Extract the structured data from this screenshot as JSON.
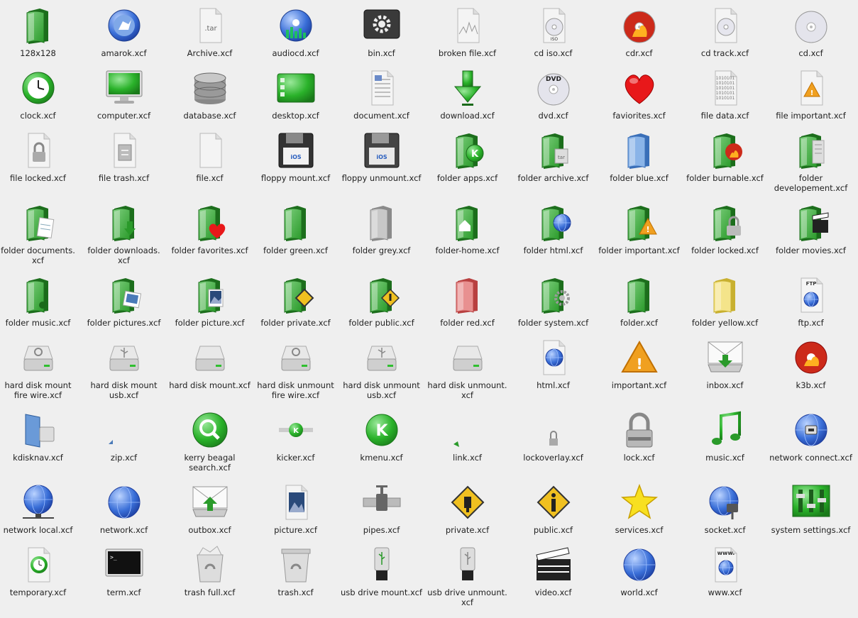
{
  "colors": {
    "background": "#efefef",
    "folder_green": "#3faf3f",
    "folder_green_dark": "#1f7f1f",
    "accent_blue": "#3a6fd8",
    "label_text": "#222222"
  },
  "rows": [
    {
      "items": [
        {
          "name": "folder-icon",
          "label": [
            "128x128"
          ]
        },
        {
          "name": "amarok-icon",
          "label": [
            "amarok.xcf"
          ]
        },
        {
          "name": "tar-archive-icon",
          "label": [
            "Archive.xcf"
          ],
          "text": ".tar"
        },
        {
          "name": "audiocd-icon",
          "label": [
            "audiocd.xcf"
          ]
        },
        {
          "name": "bin-gear-icon",
          "label": [
            "bin.xcf"
          ]
        },
        {
          "name": "broken-file-icon",
          "label": [
            "broken file.xcf"
          ]
        },
        {
          "name": "cd-iso-icon",
          "label": [
            "cd iso.xcf"
          ],
          "text": "ISO"
        },
        {
          "name": "cdr-flame-icon",
          "label": [
            "cdr.xcf"
          ]
        },
        {
          "name": "cd-track-icon",
          "label": [
            "cd track.xcf"
          ]
        },
        {
          "name": "cd-icon",
          "label": [
            "cd.xcf"
          ]
        }
      ]
    },
    {
      "items": [
        {
          "name": "clock-icon",
          "label": [
            "clock.xcf"
          ]
        },
        {
          "name": "computer-monitor-icon",
          "label": [
            "computer.xcf"
          ]
        },
        {
          "name": "database-icon",
          "label": [
            "database.xcf"
          ]
        },
        {
          "name": "desktop-icon",
          "label": [
            "desktop.xcf"
          ]
        },
        {
          "name": "document-icon",
          "label": [
            "document.xcf"
          ]
        },
        {
          "name": "download-arrow-icon",
          "label": [
            "download.xcf"
          ]
        },
        {
          "name": "dvd-icon",
          "label": [
            "dvd.xcf"
          ],
          "text": "DVD"
        },
        {
          "name": "heart-icon",
          "label": [
            "faviorites.xcf"
          ]
        },
        {
          "name": "file-data-icon",
          "label": [
            "file data.xcf"
          ],
          "text": "1010101"
        },
        {
          "name": "file-important-icon",
          "label": [
            "file important.xcf"
          ]
        }
      ]
    },
    {
      "items": [
        {
          "name": "file-locked-icon",
          "label": [
            "file locked.xcf"
          ]
        },
        {
          "name": "file-trash-icon",
          "label": [
            "file trash.xcf"
          ]
        },
        {
          "name": "file-icon",
          "label": [
            "file.xcf"
          ]
        },
        {
          "name": "floppy-mount-icon",
          "label": [
            "floppy mount.xcf"
          ],
          "text": "iOS"
        },
        {
          "name": "floppy-unmount-icon",
          "label": [
            "floppy unmount.xcf"
          ],
          "text": "iOS"
        },
        {
          "name": "folder-apps-icon",
          "label": [
            "folder apps.xcf"
          ],
          "text": "K"
        },
        {
          "name": "folder-archive-icon",
          "label": [
            "folder archive.xcf"
          ],
          "text": "tar"
        },
        {
          "name": "folder-blue-icon",
          "label": [
            "folder blue.xcf"
          ]
        },
        {
          "name": "folder-burnable-icon",
          "label": [
            "folder burnable.xcf"
          ]
        },
        {
          "name": "folder-developement-icon",
          "label": [
            "folder",
            "developement.xcf"
          ]
        }
      ]
    },
    {
      "items": [
        {
          "name": "folder-documents-icon",
          "label": [
            "folder documents.",
            "xcf"
          ]
        },
        {
          "name": "folder-downloads-icon",
          "label": [
            "folder downloads.",
            "xcf"
          ]
        },
        {
          "name": "folder-favorites-icon",
          "label": [
            "folder favorites.xcf"
          ]
        },
        {
          "name": "folder-green-icon",
          "label": [
            "folder green.xcf"
          ]
        },
        {
          "name": "folder-grey-icon",
          "label": [
            "folder grey.xcf"
          ]
        },
        {
          "name": "folder-home-icon",
          "label": [
            "folder-home.xcf"
          ]
        },
        {
          "name": "folder-html-icon",
          "label": [
            "folder html.xcf"
          ]
        },
        {
          "name": "folder-important-icon",
          "label": [
            "folder important.xcf"
          ]
        },
        {
          "name": "folder-locked-icon",
          "label": [
            "folder locked.xcf"
          ]
        },
        {
          "name": "folder-movies-icon",
          "label": [
            "folder movies.xcf"
          ]
        }
      ]
    },
    {
      "items": [
        {
          "name": "folder-music-icon",
          "label": [
            "folder music.xcf"
          ]
        },
        {
          "name": "folder-pictures-icon",
          "label": [
            "folder pictures.xcf"
          ]
        },
        {
          "name": "folder-picture-icon",
          "label": [
            "folder picture.xcf"
          ]
        },
        {
          "name": "folder-private-icon",
          "label": [
            "folder private.xcf"
          ]
        },
        {
          "name": "folder-public-icon",
          "label": [
            "folder public.xcf"
          ]
        },
        {
          "name": "folder-red-icon",
          "label": [
            "folder red.xcf"
          ]
        },
        {
          "name": "folder-system-icon",
          "label": [
            "folder system.xcf"
          ]
        },
        {
          "name": "folder-icon",
          "label": [
            "folder.xcf"
          ]
        },
        {
          "name": "folder-yellow-icon",
          "label": [
            "folder yellow.xcf"
          ]
        },
        {
          "name": "ftp-icon",
          "label": [
            "ftp.xcf"
          ],
          "text": "FTP"
        }
      ]
    },
    {
      "items": [
        {
          "name": "hard-disk-mount-firewire-icon",
          "label": [
            "hard disk mount",
            "fire wire.xcf"
          ]
        },
        {
          "name": "hard-disk-mount-usb-icon",
          "label": [
            "hard disk mount",
            "usb.xcf"
          ]
        },
        {
          "name": "hard-disk-mount-icon",
          "label": [
            "hard disk mount.xcf"
          ]
        },
        {
          "name": "hard-disk-unmount-firewire-icon",
          "label": [
            "hard disk unmount",
            "fire wire.xcf"
          ]
        },
        {
          "name": "hard-disk-unmount-usb-icon",
          "label": [
            "hard disk unmount",
            "usb.xcf"
          ]
        },
        {
          "name": "hard-disk-unmount-icon",
          "label": [
            "hard disk unmount.",
            "xcf"
          ]
        },
        {
          "name": "html-icon",
          "label": [
            "html.xcf"
          ]
        },
        {
          "name": "important-warning-icon",
          "label": [
            "important.xcf"
          ]
        },
        {
          "name": "inbox-icon",
          "label": [
            "inbox.xcf"
          ]
        },
        {
          "name": "k3b-icon",
          "label": [
            "k3b.xcf"
          ]
        }
      ]
    },
    {
      "items": [
        {
          "name": "kdisknav-icon",
          "label": [
            "kdisknav.xcf"
          ]
        },
        {
          "name": "zip-icon",
          "label": [
            "zip.xcf"
          ]
        },
        {
          "name": "kerry-beagal-search-icon",
          "label": [
            "kerry beagal",
            "search.xcf"
          ]
        },
        {
          "name": "kicker-icon",
          "label": [
            "kicker.xcf"
          ],
          "text": "K"
        },
        {
          "name": "kmenu-icon",
          "label": [
            "kmenu.xcf"
          ],
          "text": "K"
        },
        {
          "name": "link-arrow-icon",
          "label": [
            "link.xcf"
          ]
        },
        {
          "name": "lockoverlay-icon",
          "label": [
            "lockoverlay.xcf"
          ]
        },
        {
          "name": "lock-icon",
          "label": [
            "lock.xcf"
          ]
        },
        {
          "name": "music-note-icon",
          "label": [
            "music.xcf"
          ]
        },
        {
          "name": "network-connect-icon",
          "label": [
            "network connect.xcf"
          ]
        }
      ]
    },
    {
      "items": [
        {
          "name": "network-local-icon",
          "label": [
            "network local.xcf"
          ]
        },
        {
          "name": "network-globe-icon",
          "label": [
            "network.xcf"
          ]
        },
        {
          "name": "outbox-icon",
          "label": [
            "outbox.xcf"
          ]
        },
        {
          "name": "picture-icon",
          "label": [
            "picture.xcf"
          ]
        },
        {
          "name": "pipes-icon",
          "label": [
            "pipes.xcf"
          ]
        },
        {
          "name": "private-sign-icon",
          "label": [
            "private.xcf"
          ]
        },
        {
          "name": "public-sign-icon",
          "label": [
            "public.xcf"
          ]
        },
        {
          "name": "star-icon",
          "label": [
            "services.xcf"
          ]
        },
        {
          "name": "socket-icon",
          "label": [
            "socket.xcf"
          ]
        },
        {
          "name": "system-settings-icon",
          "label": [
            "system settings.xcf"
          ]
        }
      ]
    },
    {
      "items": [
        {
          "name": "temporary-icon",
          "label": [
            "temporary.xcf"
          ]
        },
        {
          "name": "terminal-icon",
          "label": [
            "term.xcf"
          ],
          "text": ">_"
        },
        {
          "name": "trash-full-icon",
          "label": [
            "trash full.xcf"
          ]
        },
        {
          "name": "trash-icon",
          "label": [
            "trash.xcf"
          ]
        },
        {
          "name": "usb-drive-mount-icon",
          "label": [
            "usb drive mount.xcf"
          ]
        },
        {
          "name": "usb-drive-unmount-icon",
          "label": [
            "usb drive unmount.",
            "xcf"
          ]
        },
        {
          "name": "video-clapper-icon",
          "label": [
            "video.xcf"
          ]
        },
        {
          "name": "world-icon",
          "label": [
            "world.xcf"
          ]
        },
        {
          "name": "www-icon",
          "label": [
            "www.xcf"
          ],
          "text": "www."
        }
      ]
    }
  ]
}
